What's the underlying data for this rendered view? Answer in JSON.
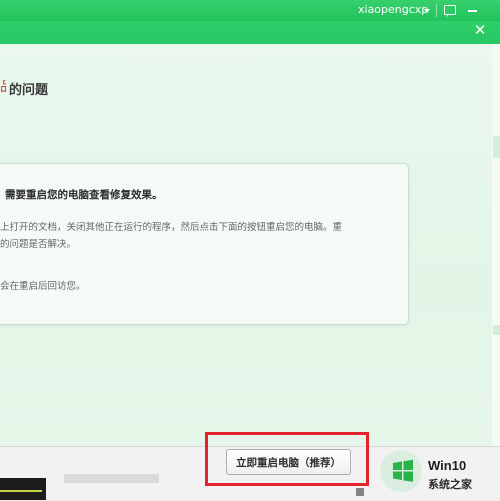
{
  "titlebar": {
    "username": "xiaopengcxp",
    "accent": "#22c35c"
  },
  "window": {
    "close_glyph": "✕"
  },
  "main": {
    "heading_icon_glyph": "品",
    "heading": "的问题",
    "card": {
      "title": "需要重启您的电脑查看修复效果。",
      "line1": "上打开的文档，关闭其他正在运行的程序，然后点击下面的按钮重启您的电脑。重",
      "line2": "的问题是否解决。",
      "line3": "会在重启后回访您。"
    }
  },
  "footer": {
    "restart_label": "立即重启电脑（推荐）",
    "highlight_color": "#e3232b"
  },
  "watermark": {
    "title": "Win10",
    "subtitle": "系统之家"
  }
}
